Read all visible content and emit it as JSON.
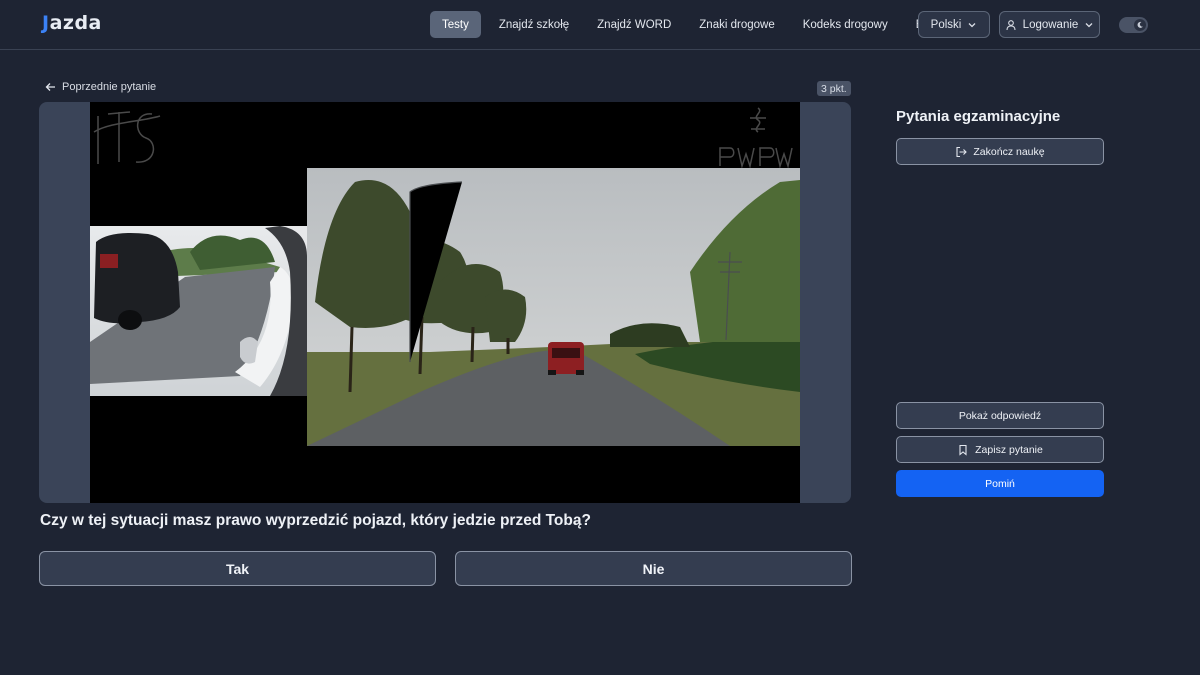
{
  "header": {
    "logo_text": "azda",
    "logo_mark": "J",
    "nav": [
      "Testy",
      "Znajdź szkołę",
      "Znajdź WORD",
      "Znaki drogowe",
      "Kodeks drogowy",
      "Blog"
    ],
    "language_label": "Polski",
    "login_label": "Logowanie",
    "theme_toggle_icon": "moon-icon"
  },
  "question_view": {
    "back_label": "Poprzednie pytanie",
    "points_badge": "3 pkt.",
    "video_watermarks": [
      "ITS",
      "PWPW"
    ],
    "question_text": "Czy w tej sytuacji masz prawo wyprzedzić pojazd, który jedzie przed Tobą?",
    "answers": [
      "Tak",
      "Nie"
    ]
  },
  "sidebar": {
    "title": "Pytania egzaminacyjne",
    "end_label": "Zakończ naukę",
    "show_answer_label": "Pokaż odpowiedź",
    "save_label": "Zapisz pytanie",
    "skip_label": "Pomiń"
  },
  "colors": {
    "background": "#1e2433",
    "primary": "#1463f3",
    "surface": "#343d50"
  }
}
